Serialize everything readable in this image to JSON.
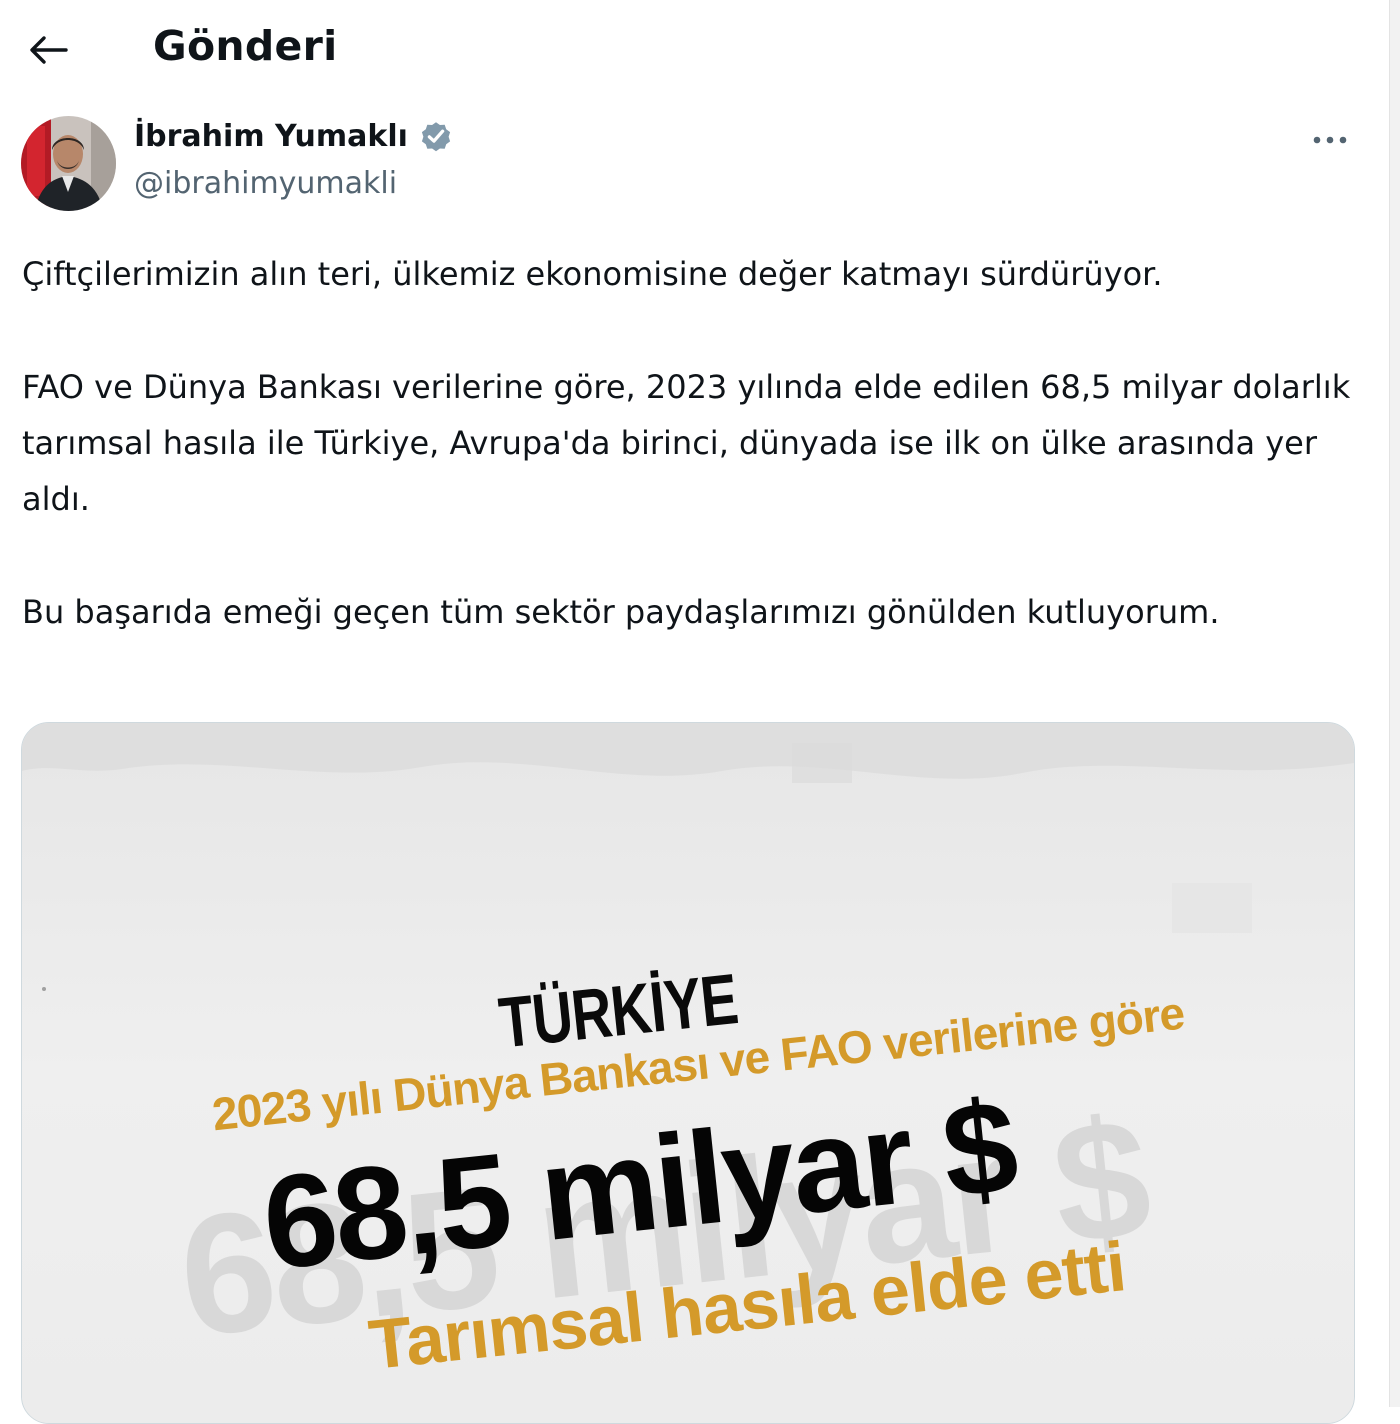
{
  "header": {
    "title": "Gönderi",
    "back_icon": "arrow-left-icon"
  },
  "author": {
    "name": "İbrahim Yumaklı",
    "handle": "@ibrahimyumakli",
    "verified": true,
    "verified_color": "#829aab"
  },
  "post": {
    "paragraphs": [
      "Çiftçilerimizin alın teri, ülkemiz ekonomisine değer katmayı sürdürüyor.",
      "FAO ve Dünya Bankası verilerine göre, 2023 yılında elde edilen 68,5 milyar dolarlık tarımsal hasıla ile Türkiye, Avrupa'da birinci, dünyada ise ilk on ülke arasında yer aldı.",
      "Bu başarıda emeği geçen tüm sektör paydaşlarımızı gönülden kutluyorum."
    ]
  },
  "image": {
    "country": "TÜRKİYE",
    "source_line": "2023 yılı Dünya Bankası ve FAO verilerine göre",
    "amount": "68,5 milyar $",
    "watermark": "68,5 milyar $",
    "caption": "Tarımsal hasıla elde etti",
    "accent_color": "#d49a2a"
  },
  "colors": {
    "text": "#0f1419",
    "secondary": "#536471"
  }
}
